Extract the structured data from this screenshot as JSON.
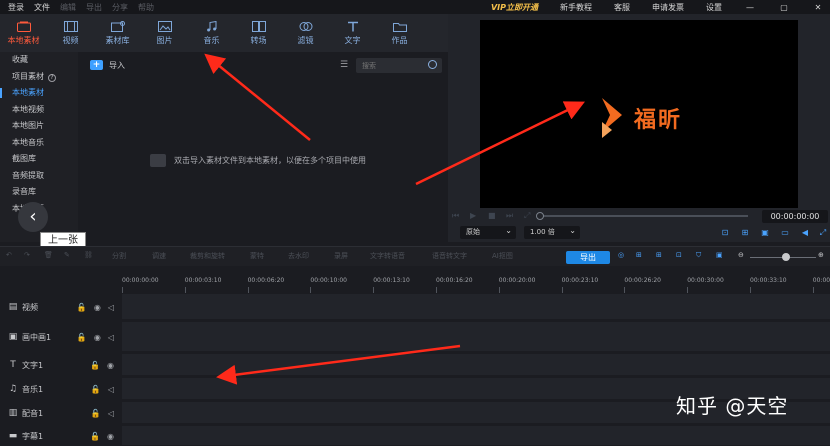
{
  "topbar": {
    "menu": [
      "登录",
      "文件",
      "编辑",
      "导出",
      "分享",
      "帮助"
    ],
    "right_items": [
      "VIP立即开通",
      "新手教程",
      "客服",
      "申请发票",
      "设置"
    ],
    "window_buttons": [
      "—",
      "▢",
      "✕"
    ]
  },
  "media_tabs": [
    {
      "label": "本地素材",
      "icon": "local-media-icon",
      "active": true
    },
    {
      "label": "视频",
      "icon": "video-icon"
    },
    {
      "label": "素材库",
      "icon": "library-icon"
    },
    {
      "label": "图片",
      "icon": "image-icon"
    },
    {
      "label": "音乐",
      "icon": "music-icon"
    },
    {
      "label": "转场",
      "icon": "transition-icon"
    },
    {
      "label": "滤镜",
      "icon": "filter-icon"
    },
    {
      "label": "文字",
      "icon": "text-icon"
    },
    {
      "label": "作品",
      "icon": "works-icon"
    }
  ],
  "sidebar": {
    "items": [
      {
        "label": "收藏"
      },
      {
        "label": "项目素材",
        "help": "?"
      },
      {
        "label": "本地素材",
        "active": true
      },
      {
        "label": "本地视频"
      },
      {
        "label": "本地图片"
      },
      {
        "label": "本地音乐"
      },
      {
        "label": "截图库"
      },
      {
        "label": "音频提取"
      },
      {
        "label": "录音库"
      },
      {
        "label": "本地字幕"
      }
    ]
  },
  "library": {
    "import_label": "导入",
    "search_placeholder": "搜索",
    "empty_text": "双击导入素材文件到本地素材，以便在多个项目中使用"
  },
  "nav": {
    "prev_tooltip": "上一张"
  },
  "preview": {
    "logo_text": "福昕",
    "brand_color": "#f26b20",
    "timecode": "00:00:00:00",
    "aspect_select": "原始",
    "speed_select": "1.00 倍"
  },
  "toolbar": {
    "tools": [
      "分割",
      "调速",
      "裁剪和旋转",
      "蒙特",
      "去水印",
      "录屏",
      "文字转语音",
      "语音转文字",
      "AI抠图"
    ],
    "export_label": "导出"
  },
  "ruler": {
    "labels": [
      "00:00:00:00",
      "00:00:03:10",
      "00:00:06:20",
      "00:00:10:00",
      "00:00:13:10",
      "00:00:16:20",
      "00:00:20:00",
      "00:00:23:10",
      "00:00:26:20",
      "00:00:30:00",
      "00:00:33:10",
      "00:00:36:"
    ]
  },
  "tracks": [
    {
      "name": "视频",
      "icon": "video-track-icon",
      "glyph": "▤"
    },
    {
      "name": "画中画1",
      "icon": "pip-track-icon",
      "glyph": "▣"
    },
    {
      "name": "文字1",
      "icon": "text-track-icon",
      "glyph": "T"
    },
    {
      "name": "音乐1",
      "icon": "music-track-icon",
      "glyph": "♫"
    },
    {
      "name": "配音1",
      "icon": "voice-track-icon",
      "glyph": "▥"
    },
    {
      "name": "字幕1",
      "icon": "subtitle-track-icon",
      "glyph": "▬"
    }
  ],
  "watermark": "知乎 @天空",
  "colors": {
    "accent": "#1e88e5",
    "active_tab": "#ff5a3c",
    "arrow": "#ff2a1a"
  }
}
